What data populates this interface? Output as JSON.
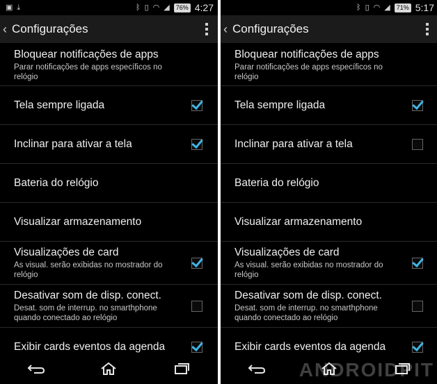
{
  "screens": [
    {
      "status": {
        "battery": "76%",
        "time": "4:27"
      },
      "title": "Configurações",
      "rows": [
        {
          "title": "Bloquear notificações de apps",
          "sub": "Parar notificações de apps específicos no relógio"
        },
        {
          "title": "Tela sempre ligada",
          "checked": true
        },
        {
          "title": "Inclinar para ativar a tela",
          "checked": true
        },
        {
          "title": "Bateria do relógio"
        },
        {
          "title": "Visualizar armazenamento"
        },
        {
          "title": "Visualizações de card",
          "sub": "As visual. serão exibidas no mostrador do relógio",
          "checked": true
        },
        {
          "title": "Desativar som de disp. conect.",
          "sub": "Desat. som de interrup. no smarthphone quando conectado ao relógio",
          "checked": false
        },
        {
          "title": "Exibir cards eventos da agenda",
          "checked": true
        }
      ]
    },
    {
      "status": {
        "battery": "71%",
        "time": "5:17"
      },
      "title": "Configurações",
      "rows": [
        {
          "title": "Bloquear notificações de apps",
          "sub": "Parar notificações de apps específicos no relógio"
        },
        {
          "title": "Tela sempre ligada",
          "checked": true
        },
        {
          "title": "Inclinar para ativar a tela",
          "checked": false
        },
        {
          "title": "Bateria do relógio"
        },
        {
          "title": "Visualizar armazenamento"
        },
        {
          "title": "Visualizações de card",
          "sub": "As visual. serão exibidas no mostrador do relógio",
          "checked": true
        },
        {
          "title": "Desativar som de disp. conect.",
          "sub": "Desat. som de interrup. no smarthphone quando conectado ao relógio",
          "checked": false
        },
        {
          "title": "Exibir cards eventos da agenda",
          "checked": true
        }
      ]
    }
  ],
  "watermark": "ANDROIDPIT",
  "icons": {
    "status_left": [
      "image-icon",
      "download-icon"
    ],
    "status_right": [
      "bluetooth-icon",
      "vibrate-icon",
      "wifi-icon",
      "signal-icon",
      "battery-icon"
    ],
    "nav": [
      "back-icon",
      "home-icon",
      "recents-icon"
    ]
  }
}
